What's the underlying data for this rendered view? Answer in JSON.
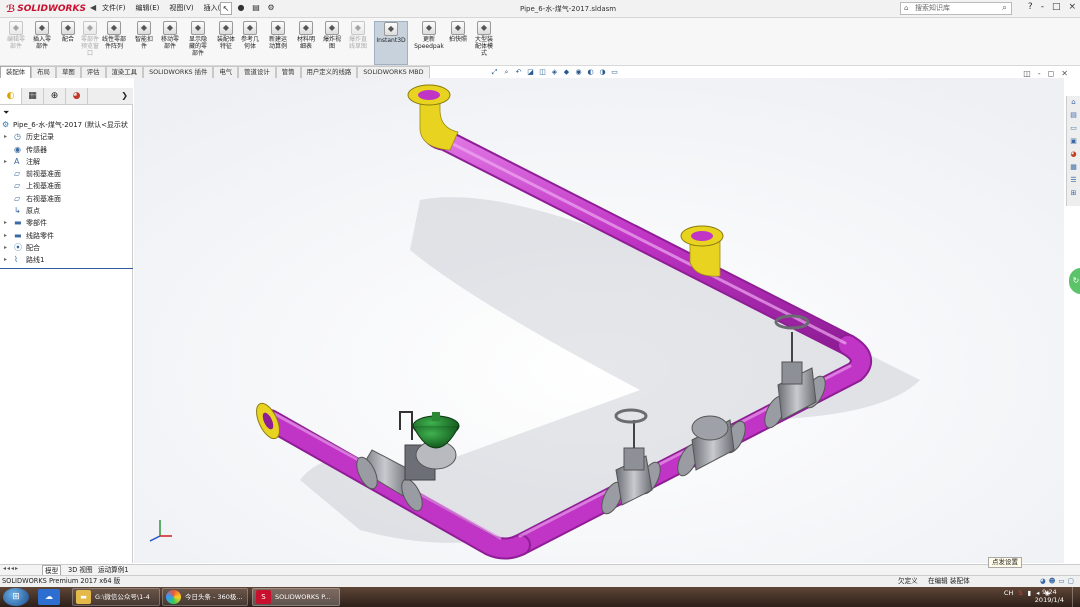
{
  "app": {
    "brand": "SOLIDWORKS",
    "document_title": "Pipe_6-水-煤气-2017.sldasm",
    "menu": [
      "文件(F)",
      "编辑(E)",
      "视图(V)",
      "插入(I)"
    ],
    "search_placeholder": "搜索知识库",
    "window_controls": [
      "?",
      "-",
      "□",
      "×"
    ]
  },
  "ribbon": {
    "buttons": [
      {
        "label": "编辑零\n部件",
        "icon": "edit-component-icon",
        "disabled": true
      },
      {
        "label": "插入零\n部件",
        "icon": "insert-component-icon",
        "disabled": false
      },
      {
        "label": "配合",
        "icon": "mate-icon",
        "disabled": false
      },
      {
        "label": "零部件\n预览窗\n口",
        "icon": "component-preview-icon",
        "disabled": true
      },
      {
        "label": "线性零部\n件阵列",
        "icon": "linear-pattern-icon",
        "disabled": false
      },
      {
        "label": "智能扣\n件",
        "icon": "smart-fasteners-icon",
        "disabled": false
      },
      {
        "label": "移动零\n部件",
        "icon": "move-component-icon",
        "disabled": false
      },
      {
        "label": "显示隐\n藏的零\n部件",
        "icon": "show-hidden-icon",
        "disabled": false
      },
      {
        "label": "装配体\n特征",
        "icon": "assembly-features-icon",
        "disabled": false
      },
      {
        "label": "参考几\n何体",
        "icon": "reference-geometry-icon",
        "disabled": false
      },
      {
        "label": "新建运\n动算例",
        "icon": "new-motion-study-icon",
        "disabled": false
      },
      {
        "label": "材料明\n细表",
        "icon": "bom-icon",
        "disabled": false
      },
      {
        "label": "爆炸视\n图",
        "icon": "exploded-view-icon",
        "disabled": false
      },
      {
        "label": "爆炸直\n线草图",
        "icon": "explode-line-sketch-icon",
        "disabled": true
      },
      {
        "label": "Instant3D",
        "icon": "instant3d-icon",
        "disabled": false
      },
      {
        "label": "更新\nSpeedpak",
        "icon": "speedpak-icon",
        "disabled": false
      },
      {
        "label": "拍快照",
        "icon": "snapshot-icon",
        "disabled": false
      },
      {
        "label": "大型装\n配体模\n式",
        "icon": "large-assembly-icon",
        "disabled": false
      }
    ]
  },
  "tabs": [
    "装配体",
    "布局",
    "草图",
    "评估",
    "渲染工具",
    "SOLIDWORKS 插件",
    "电气",
    "管道设计",
    "管筒",
    "用户定义的线路",
    "SOLIDWORKS MBD"
  ],
  "feature_tree": {
    "root": "Pipe_6-水-煤气-2017 (默认<显示状",
    "items": [
      {
        "label": "历史记录",
        "icon": "history-icon",
        "expandable": true
      },
      {
        "label": "传感器",
        "icon": "sensor-icon",
        "expandable": false
      },
      {
        "label": "注解",
        "icon": "annotation-icon",
        "expandable": true
      },
      {
        "label": "前视基准面",
        "icon": "plane-icon",
        "expandable": false
      },
      {
        "label": "上视基准面",
        "icon": "plane-icon",
        "expandable": false
      },
      {
        "label": "右视基准面",
        "icon": "plane-icon",
        "expandable": false
      },
      {
        "label": "原点",
        "icon": "origin-icon",
        "expandable": false
      },
      {
        "label": "零部件",
        "icon": "folder-icon",
        "expandable": true
      },
      {
        "label": "线路零件",
        "icon": "folder-icon",
        "expandable": true
      },
      {
        "label": "配合",
        "icon": "mates-icon",
        "expandable": true
      },
      {
        "label": "路线1",
        "icon": "route-icon",
        "expandable": true
      }
    ]
  },
  "bottom_tabs": [
    "模型",
    "3D 视图",
    "运动算例1"
  ],
  "tooltip": "点发设置",
  "status": {
    "left": "SOLIDWORKS Premium 2017 x64 版",
    "state": "欠定义",
    "editing": "在编辑 装配体"
  },
  "taskbar": {
    "tasks": [
      "G:\\微信公众号\\1-4",
      "今日头条 - 360极...",
      "SOLIDWORKS P..."
    ],
    "lang": "CH",
    "time": "9:24",
    "date": "2019/1/4"
  },
  "colors": {
    "pipe": "#c035c5",
    "flange": "#e8d420",
    "valve_body": "#8e9098",
    "actuator": "#1f7a2b",
    "selected_ribbon": "#c8d2dc"
  }
}
